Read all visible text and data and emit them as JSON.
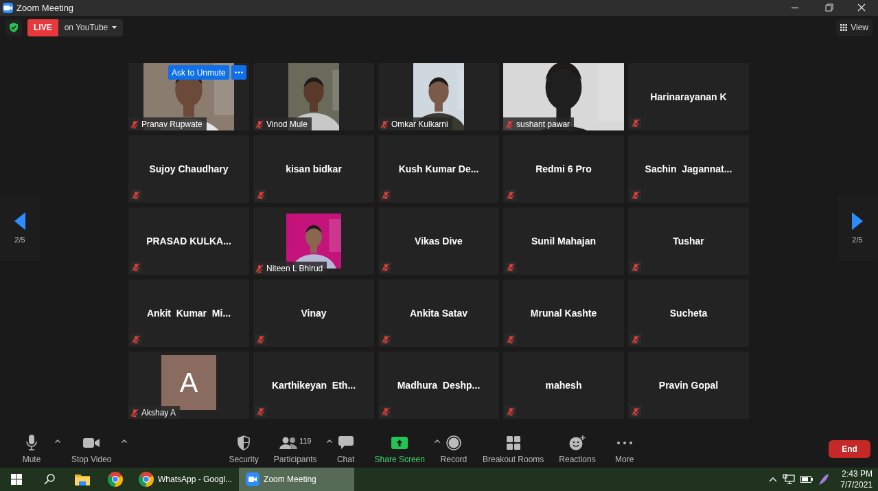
{
  "window": {
    "title": "Zoom Meeting"
  },
  "top_bar": {
    "live_badge": "LIVE",
    "stream_target": "on YouTube",
    "view_button": "View"
  },
  "pager": {
    "left": "2/5",
    "right": "2/5"
  },
  "tiles": [
    {
      "kind": "video",
      "name": "Pranav Rupwate",
      "muted": true,
      "ask_button": "Ask to Unmute"
    },
    {
      "kind": "video",
      "name": "Vinod Mule",
      "muted": true
    },
    {
      "kind": "video",
      "name": "Omkar Kulkarni",
      "muted": true
    },
    {
      "kind": "video",
      "name": "sushant pawar",
      "muted": true
    },
    {
      "kind": "name",
      "name": "Harinarayanan K",
      "muted": true
    },
    {
      "kind": "name",
      "name": "Sujoy Chaudhary",
      "muted": true
    },
    {
      "kind": "name",
      "name": "kisan bidkar",
      "muted": true
    },
    {
      "kind": "name",
      "name": "Kush Kumar De...",
      "muted": true
    },
    {
      "kind": "name",
      "name": "Redmi 6 Pro",
      "muted": true
    },
    {
      "kind": "name",
      "name": "Sachin  Jagannat...",
      "muted": true
    },
    {
      "kind": "name",
      "name": "PRASAD KULKA...",
      "muted": true
    },
    {
      "name": "Niteen L Bhirud",
      "muted": true
    },
    {
      "kind": "name",
      "name": "Vikas Dive",
      "muted": true
    },
    {
      "kind": "name",
      "name": "Sunil Mahajan",
      "muted": true
    },
    {
      "kind": "name",
      "name": "Tushar",
      "muted": true
    },
    {
      "kind": "name",
      "name": "Ankit  Kumar  Mi...",
      "muted": true
    },
    {
      "kind": "name",
      "name": "Vinay",
      "muted": true
    },
    {
      "kind": "name",
      "name": "Ankita Satav",
      "muted": true
    },
    {
      "kind": "name",
      "name": "Mrunal Kashte",
      "muted": true
    },
    {
      "kind": "name",
      "name": "Sucheta",
      "muted": true
    },
    {
      "kind": "avatar",
      "initial": "A",
      "name": "Akshay A",
      "muted": true
    },
    {
      "kind": "name",
      "name": "Karthikeyan  Eth...",
      "muted": true
    },
    {
      "kind": "name",
      "name": "Madhura  Deshp...",
      "muted": true
    },
    {
      "kind": "name",
      "name": "mahesh",
      "muted": true
    },
    {
      "kind": "name",
      "name": "Pravin Gopal",
      "muted": true
    }
  ],
  "toolbar": {
    "left": [
      {
        "kind": "mic",
        "label": "Mute",
        "caret": true,
        "active": false
      },
      {
        "kind": "camera",
        "label": "Stop Video",
        "caret": true,
        "active": false
      }
    ],
    "center": [
      {
        "kind": "shield",
        "label": "Security",
        "caret": false,
        "active": false
      },
      {
        "kind": "people",
        "label": "Participants",
        "count": "119",
        "caret": true,
        "active": false
      },
      {
        "kind": "chat",
        "label": "Chat",
        "caret": false,
        "active": false
      },
      {
        "kind": "share",
        "label": "Share Screen",
        "caret": true,
        "active": true
      },
      {
        "kind": "record",
        "label": "Record",
        "caret": false,
        "active": false
      },
      {
        "kind": "grid",
        "label": "Breakout Rooms",
        "caret": false,
        "active": false
      },
      {
        "kind": "smile",
        "label": "Reactions",
        "caret": false,
        "active": false
      },
      {
        "kind": "dots",
        "label": "More",
        "caret": false,
        "active": false
      }
    ],
    "end_button": "End"
  },
  "taskbar": {
    "apps": [
      {
        "kind": "windows",
        "selected": false
      },
      {
        "kind": "search",
        "selected": false
      },
      {
        "kind": "folder",
        "selected": false
      },
      {
        "kind": "chrome",
        "selected": false
      },
      {
        "kind": "chrome",
        "label": "WhatsApp - Googl...",
        "selected": false
      },
      {
        "kind": "zoom",
        "label": "Zoom Meeting",
        "selected": true
      }
    ],
    "time": "2:43 PM",
    "date": "7/7/2021"
  }
}
